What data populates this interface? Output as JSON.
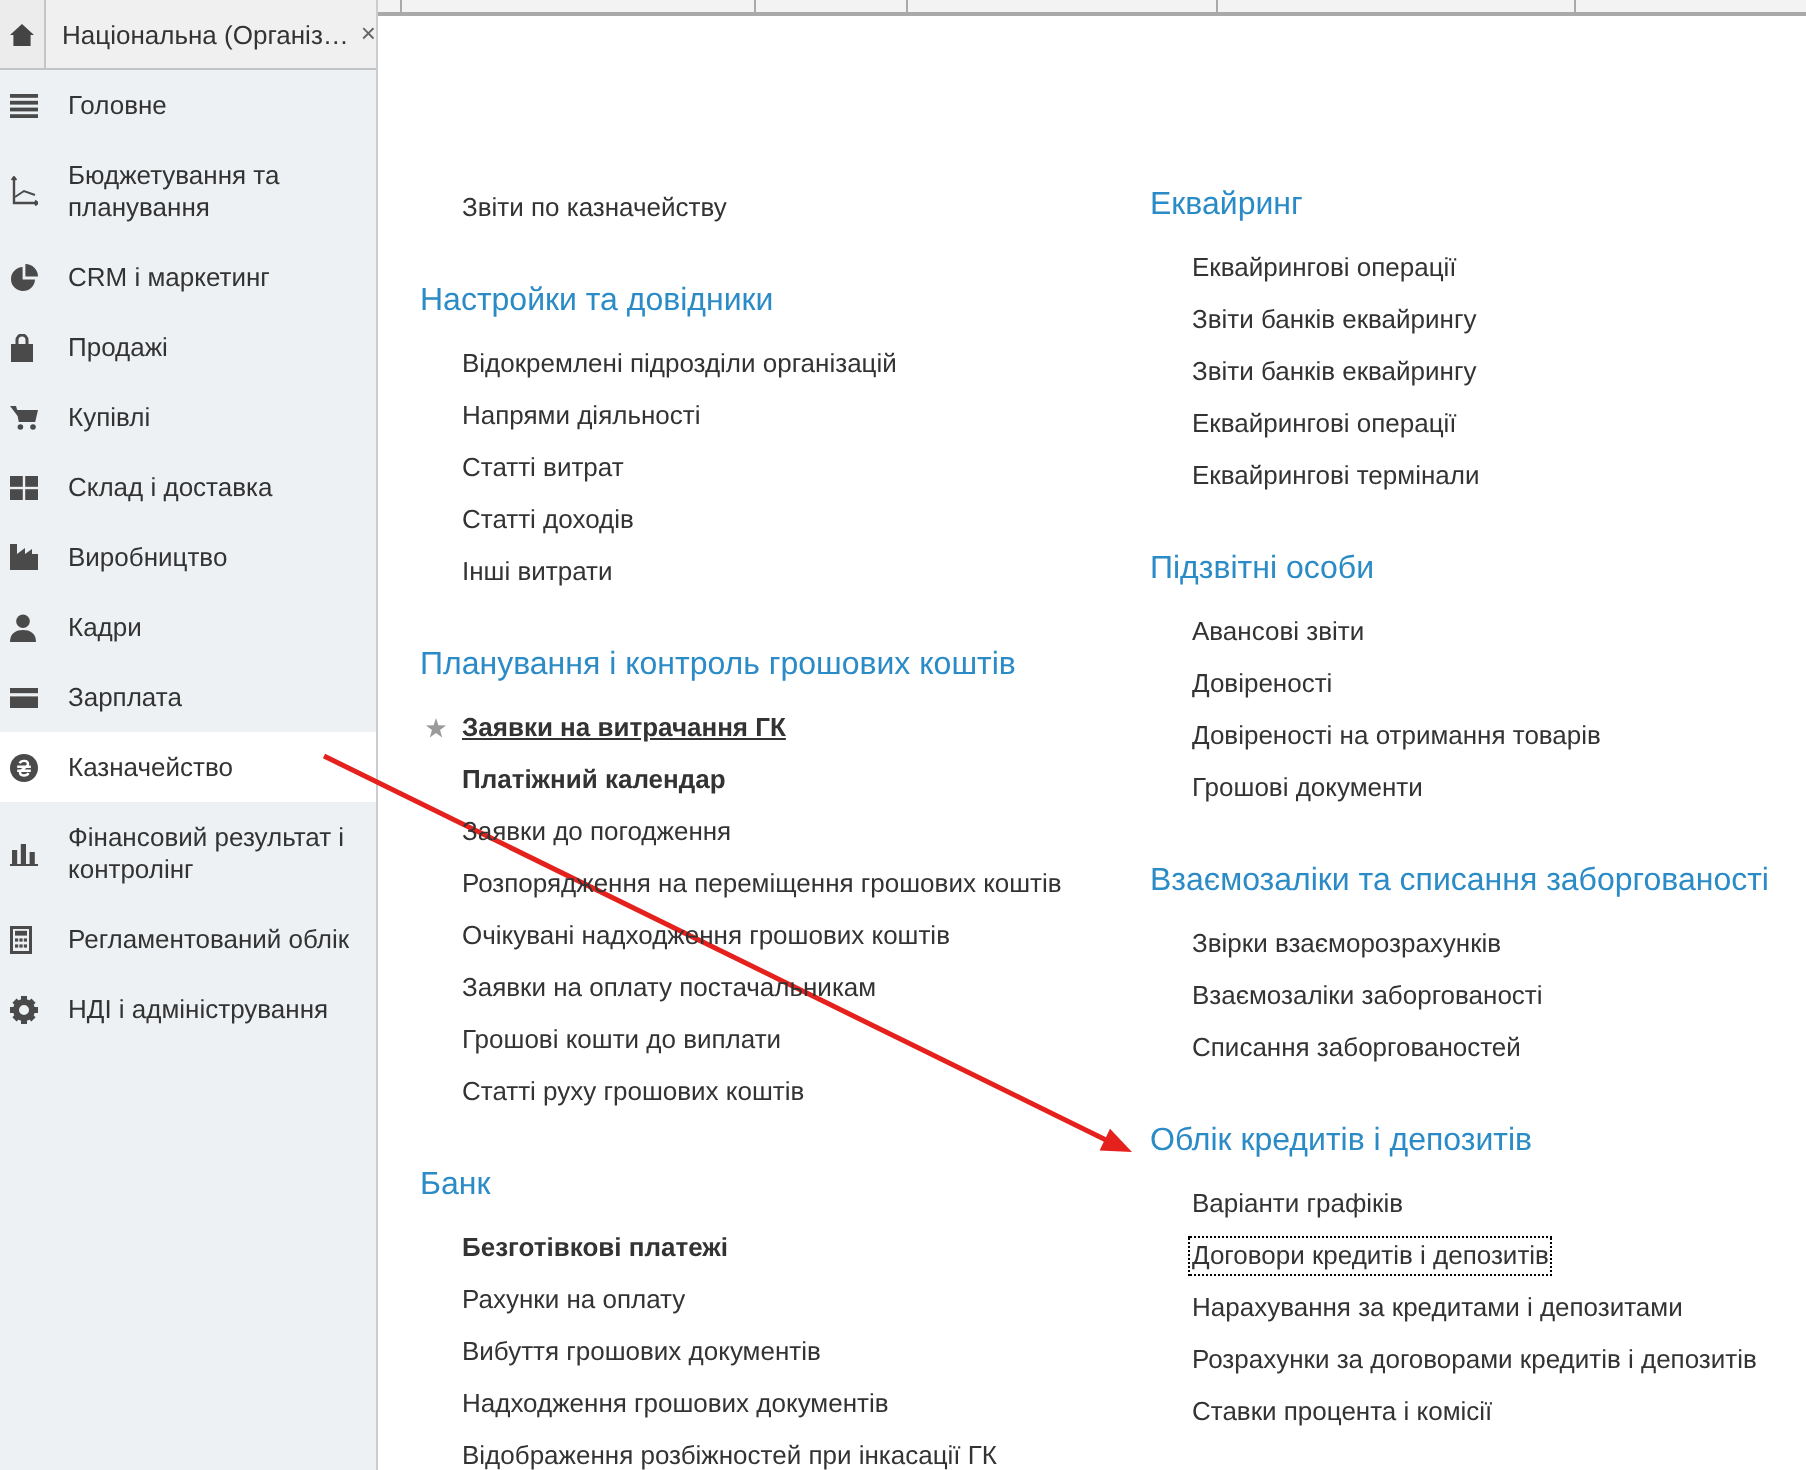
{
  "tab_bar": {
    "tab": {
      "title": "Національна (Організ…",
      "close_glyph": "×"
    }
  },
  "sidebar": {
    "items": [
      {
        "label": "Головне",
        "selected": false
      },
      {
        "label": "Бюджетування та планування",
        "selected": false
      },
      {
        "label": "CRM і маркетинг",
        "selected": false
      },
      {
        "label": "Продажі",
        "selected": false
      },
      {
        "label": "Купівлі",
        "selected": false
      },
      {
        "label": "Склад і доставка",
        "selected": false
      },
      {
        "label": "Виробництво",
        "selected": false
      },
      {
        "label": "Кадри",
        "selected": false
      },
      {
        "label": "Зарплата",
        "selected": false
      },
      {
        "label": "Казначейство",
        "selected": true
      },
      {
        "label": "Фінансовий результат і контролінг",
        "selected": false
      },
      {
        "label": "Регламентований облік",
        "selected": false
      },
      {
        "label": "НДІ і адміністрування",
        "selected": false
      }
    ]
  },
  "content": {
    "columns": [
      {
        "sections": [
          {
            "items": [
              {
                "label": "Звіти по казначейству",
                "kind": "plain"
              }
            ]
          },
          {
            "heading": "Настройки та довідники",
            "items": [
              {
                "label": "Відокремлені підрозділи організацій",
                "kind": "plain"
              },
              {
                "label": "Напрями діяльності",
                "kind": "plain"
              },
              {
                "label": "Статті витрат",
                "kind": "plain"
              },
              {
                "label": "Статті доходів",
                "kind": "plain"
              },
              {
                "label": "Інші витрати",
                "kind": "plain"
              }
            ]
          },
          {
            "heading": "Планування і контроль грошових коштів",
            "items": [
              {
                "label": "Заявки на витрачання ГК",
                "kind": "starred"
              },
              {
                "label": "Платіжний календар",
                "kind": "bold"
              },
              {
                "label": "Заявки до погодження",
                "kind": "plain"
              },
              {
                "label": "Розпорядження на переміщення грошових коштів",
                "kind": "plain"
              },
              {
                "label": "Очікувані надходження грошових коштів",
                "kind": "plain"
              },
              {
                "label": "Заявки на оплату постачальникам",
                "kind": "plain"
              },
              {
                "label": "Грошові кошти до виплати",
                "kind": "plain"
              },
              {
                "label": "Статті руху грошових коштів",
                "kind": "plain"
              }
            ]
          },
          {
            "heading": "Банк",
            "items": [
              {
                "label": "Безготівкові платежі",
                "kind": "bold"
              },
              {
                "label": "Рахунки на оплату",
                "kind": "plain"
              },
              {
                "label": "Вибуття грошових документів",
                "kind": "plain"
              },
              {
                "label": "Надходження грошових документів",
                "kind": "plain"
              },
              {
                "label": "Відображення розбіжностей при інкасації ГК",
                "kind": "plain"
              }
            ]
          }
        ]
      },
      {
        "sections": [
          {
            "heading": "Еквайринг",
            "items": [
              {
                "label": "Еквайрингові операції",
                "kind": "plain"
              },
              {
                "label": "Звіти банків еквайрингу",
                "kind": "plain"
              },
              {
                "label": "Звіти банків еквайрингу",
                "kind": "plain"
              },
              {
                "label": "Еквайрингові операції",
                "kind": "plain"
              },
              {
                "label": "Еквайрингові термінали",
                "kind": "plain"
              }
            ]
          },
          {
            "heading": "Підзвітні особи",
            "items": [
              {
                "label": "Авансові звіти",
                "kind": "plain"
              },
              {
                "label": "Довіреності",
                "kind": "plain"
              },
              {
                "label": "Довіреності на отримання товарів",
                "kind": "plain"
              },
              {
                "label": "Грошові документи",
                "kind": "plain"
              }
            ]
          },
          {
            "heading": "Взаємозаліки та списання заборгованості",
            "items": [
              {
                "label": "Звірки взаєморозрахунків",
                "kind": "plain"
              },
              {
                "label": "Взаємозаліки заборгованості",
                "kind": "plain"
              },
              {
                "label": "Списання заборгованостей",
                "kind": "plain"
              }
            ]
          },
          {
            "heading": "Облік кредитів і депозитів",
            "items": [
              {
                "label": "Варіанти графіків",
                "kind": "plain"
              },
              {
                "label": "Договори кредитів і депозитів",
                "kind": "focused"
              },
              {
                "label": "Нарахування за кредитами і депозитами",
                "kind": "plain"
              },
              {
                "label": "Розрахунки за договорами кредитів і депозитів",
                "kind": "plain"
              },
              {
                "label": "Ставки процента і комісії",
                "kind": "plain"
              }
            ]
          }
        ]
      }
    ]
  }
}
